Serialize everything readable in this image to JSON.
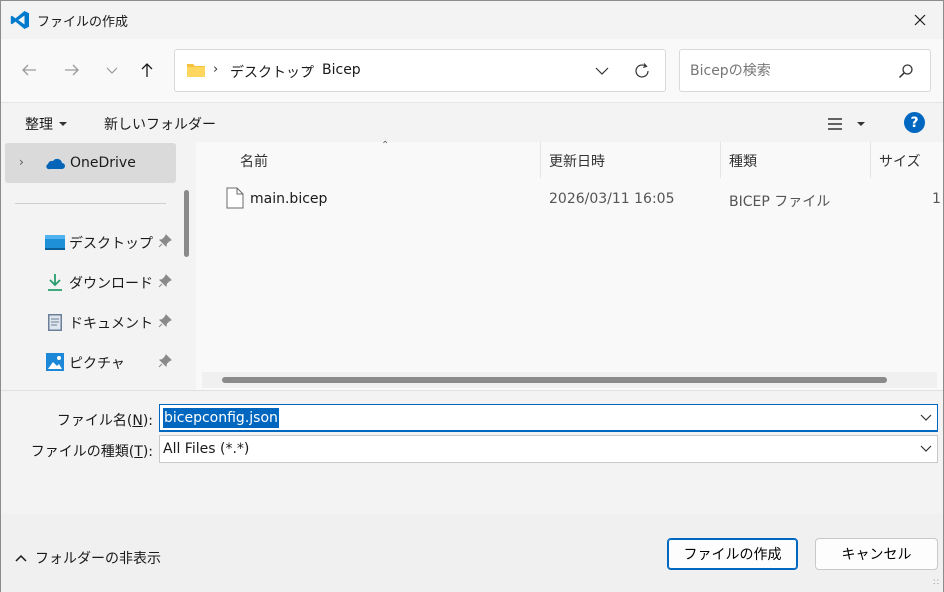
{
  "window": {
    "title": "ファイルの作成",
    "colors": {
      "accent": "#0067c0",
      "app_icon": "#007acc",
      "folder": "#f5c33b",
      "onedrive": "#0364b8"
    }
  },
  "address": {
    "crumbs": [
      "デスクトップ",
      "Bicep"
    ]
  },
  "search": {
    "placeholder": "Bicepの検索"
  },
  "toolbar": {
    "organize_label": "整理",
    "new_folder_label": "新しいフォルダー"
  },
  "nav": {
    "onedrive": "OneDrive",
    "items": [
      {
        "label": "デスクトップ",
        "icon": "desktop-icon"
      },
      {
        "label": "ダウンロード",
        "icon": "download-icon"
      },
      {
        "label": "ドキュメント",
        "icon": "document-icon"
      },
      {
        "label": "ピクチャ",
        "icon": "pictures-icon"
      }
    ]
  },
  "columns": {
    "name": "名前",
    "date": "更新日時",
    "type": "種類",
    "size": "サイズ"
  },
  "files": [
    {
      "name": "main.bicep",
      "date": "2026/03/11 16:05",
      "type": "BICEP ファイル",
      "size": "1"
    }
  ],
  "form": {
    "filename_label": "ファイル名(",
    "filename_key": "N",
    "filename_label_end": "):",
    "filename_value": "bicepconfig.json",
    "filetype_label": "ファイルの種類(",
    "filetype_key": "T",
    "filetype_label_end": "):",
    "filetype_value": "All Files (*.*)"
  },
  "footer": {
    "hide_folders": "フォルダーの非表示",
    "create_button": "ファイルの作成",
    "cancel_button": "キャンセル"
  }
}
